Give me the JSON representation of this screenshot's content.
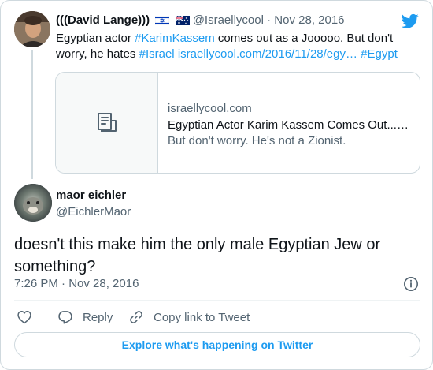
{
  "parent_tweet": {
    "display_name": "(((David Lange)))",
    "flags": [
      "israel-flag-icon",
      "australia-flag-icon"
    ],
    "handle": "@Israellycool",
    "separator": "·",
    "date": "Nov 28, 2016",
    "text_part1": "Egyptian actor ",
    "hashtag1": "#KarimKassem",
    "text_part2": " comes out as a Jooooo. But don't worry, he hates ",
    "hashtag2": "#Israel",
    "link": "israellycool.com/2016/11/28/egy…",
    "hashtag3": "#Egypt",
    "preview": {
      "icon": "document-icon",
      "domain": "israellycool.com",
      "title": "Egyptian Actor Karim Kassem Comes Out...…",
      "description": "But don't worry. He's not a Zionist."
    }
  },
  "reply_tweet": {
    "display_name": "maor eichler",
    "handle": "@EichlerMaor",
    "text": "doesn't this make him the only male Egyptian Jew or something?",
    "timestamp": "7:26 PM · Nov 28, 2016"
  },
  "actions": {
    "like_icon": "heart-icon",
    "reply_label": "Reply",
    "copy_label": "Copy link to Tweet"
  },
  "explore_label": "Explore what's happening on Twitter",
  "colors": {
    "accent": "#1d9bf0",
    "text": "#0f1419",
    "secondary": "#536471",
    "border": "#cfd9de"
  }
}
